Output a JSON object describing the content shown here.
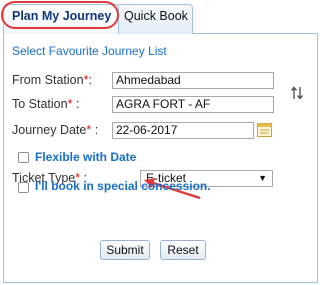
{
  "tabs": {
    "active": "Plan My Journey",
    "inactive": "Quick Book"
  },
  "links": {
    "favourite": "Select Favourite Journey List"
  },
  "form": {
    "from_label": "From Station",
    "from_value": "Ahmedabad",
    "to_label": "To Station",
    "to_value": "AGRA FORT - AF",
    "date_label": "Journey Date",
    "date_value": "22-06-2017",
    "flexible_label": "Flexible with Date",
    "ticket_type_label": "Ticket Type",
    "ticket_type_value": "E-ticket",
    "concession_label": "I'll book in special concession.",
    "required_mark": "*",
    "colon": ":"
  },
  "buttons": {
    "submit": "Submit",
    "reset": "Reset"
  },
  "colors": {
    "accent_blue": "#1a6fc8",
    "highlight_red": "#e23a3a"
  },
  "icons": [
    "swap-icon",
    "calendar-icon",
    "dropdown-caret-icon",
    "annotation-arrow"
  ]
}
